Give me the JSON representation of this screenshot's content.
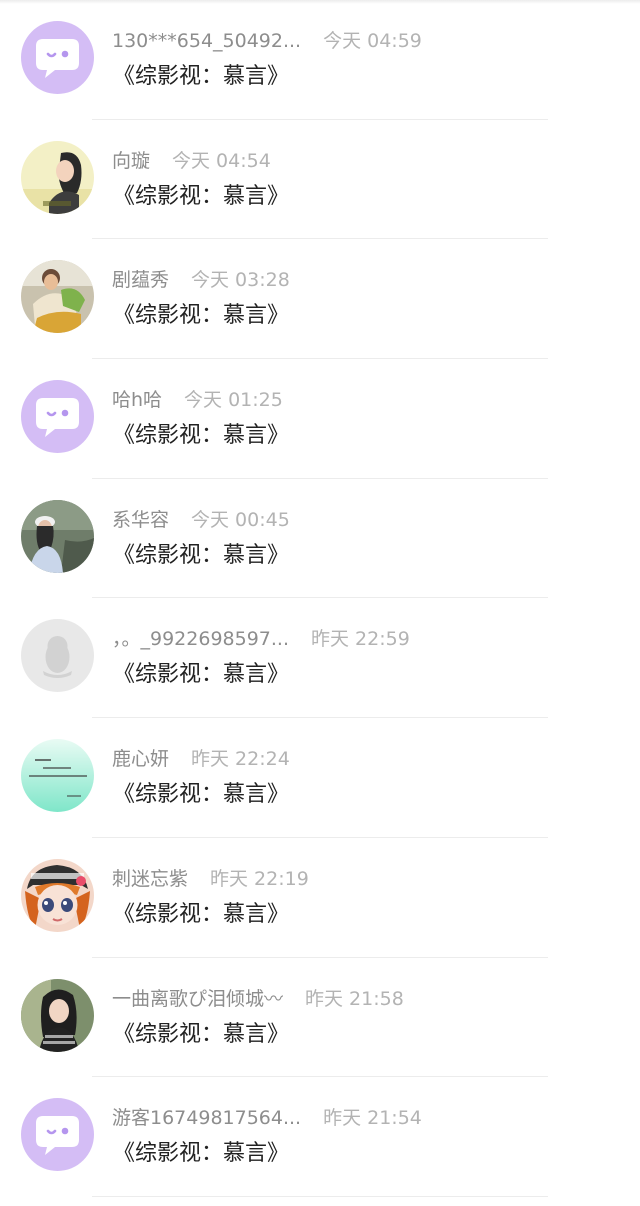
{
  "colors": {
    "default_avatar_bg": "#d4bdf5",
    "default_avatar_bubble": "#ffffff",
    "default_avatar_accent": "#b596ee",
    "qq_placeholder_bg": "#e8e8e8",
    "name_text": "#8d8d8d",
    "time_text": "#b3b3b3",
    "message_text": "#222222",
    "divider": "#ececec"
  },
  "comments": [
    {
      "name": "130***654_50492...",
      "time": "今天 04:59",
      "text": "《综影视：慕言》",
      "avatar": "default-chat-bubble-icon"
    },
    {
      "name": "向璇",
      "time": "今天 04:54",
      "text": "《综影视：慕言》",
      "avatar": "user-photo-avatar"
    },
    {
      "name": "剧蕴秀",
      "time": "今天 03:28",
      "text": "《综影视：慕言》",
      "avatar": "user-photo-avatar"
    },
    {
      "name": "哈h哈",
      "time": "今天 01:25",
      "text": "《综影视：慕言》",
      "avatar": "default-chat-bubble-icon"
    },
    {
      "name": "系华容",
      "time": "今天 00:45",
      "text": "《综影视：慕言》",
      "avatar": "user-photo-avatar"
    },
    {
      "name": "，。_9922698597...",
      "time": "昨天 22:59",
      "text": "《综影视：慕言》",
      "avatar": "qq-penguin-placeholder-icon"
    },
    {
      "name": "鹿心妍",
      "time": "昨天 22:24",
      "text": "《综影视：慕言》",
      "avatar": "user-text-image-avatar"
    },
    {
      "name": "刺迷忘紫",
      "time": "昨天 22:19",
      "text": "《综影视：慕言》",
      "avatar": "user-cartoon-avatar"
    },
    {
      "name": "一曲离歌ぴ泪倾城〰",
      "time": "昨天 21:58",
      "text": "《综影视：慕言》",
      "avatar": "user-photo-avatar"
    },
    {
      "name": "游客16749817564...",
      "time": "昨天 21:54",
      "text": "《综影视：慕言》",
      "avatar": "default-chat-bubble-icon"
    }
  ]
}
